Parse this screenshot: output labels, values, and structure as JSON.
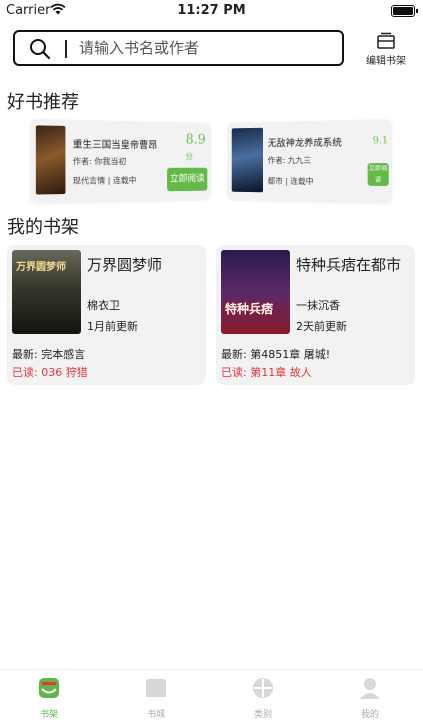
{
  "status_bar": {
    "carrier": "Carrier",
    "time": "11:27 PM"
  },
  "search": {
    "placeholder": "请输入书名或作者"
  },
  "edit_shelf": {
    "label": "编辑书架"
  },
  "recommend": {
    "title": "好书推荐",
    "items": [
      {
        "title": "重生三国当皇帝曹昂",
        "author": "作者: 你我当初",
        "tags": "现代言情 | 连载中",
        "score": "8.9",
        "score_unit": "分",
        "button": "立即阅读"
      },
      {
        "title": "无敌神龙养成系统",
        "author": "作者: 九九三",
        "tags": "都市 | 连载中",
        "score": "9.1",
        "button": "立即阅读"
      }
    ]
  },
  "shelf": {
    "title": "我的书架",
    "books": [
      {
        "title": "万界圆梦师",
        "author": "棉衣卫",
        "updated": "1月前更新",
        "latest": "最新:  完本感言",
        "read": "已读:  036 狩猎",
        "cover_text": "万界圆梦师"
      },
      {
        "title": "特种兵痞在都市",
        "author": "一抹沉香",
        "updated": "2天前更新",
        "latest": "最新:  第4851章 屠城!",
        "read": "已读:  第11章 故人",
        "cover_text": "特种兵痞"
      }
    ]
  },
  "tabs": [
    {
      "label": "书架",
      "icon": "bookshelf-icon",
      "active": true
    },
    {
      "label": "书城",
      "icon": "bookstore-icon",
      "active": false
    },
    {
      "label": "类别",
      "icon": "category-icon",
      "active": false
    },
    {
      "label": "我的",
      "icon": "profile-icon",
      "active": false
    }
  ],
  "colors": {
    "accent": "#5fb54a",
    "read_red": "#e8323c",
    "card_bg": "#f2f2f2"
  }
}
